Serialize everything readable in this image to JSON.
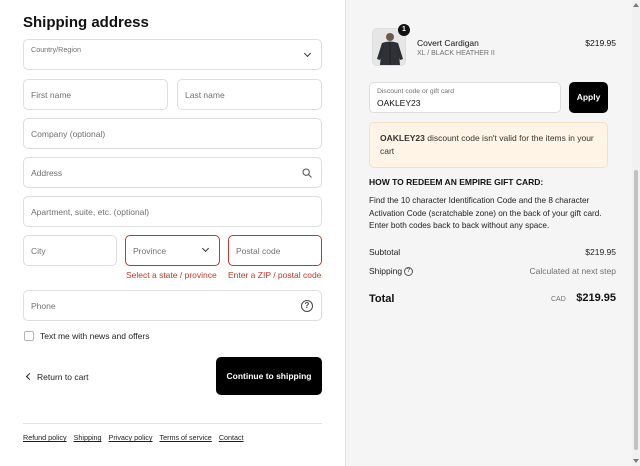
{
  "shipping": {
    "heading": "Shipping address",
    "country_label": "Country/Region",
    "first_name_ph": "First name",
    "last_name_ph": "Last name",
    "company_ph": "Company (optional)",
    "address_ph": "Address",
    "apartment_ph": "Apartment, suite, etc. (optional)",
    "city_ph": "City",
    "province_ph": "Province",
    "postal_ph": "Postal code",
    "province_error": "Select a state / province",
    "postal_error": "Enter a ZIP / postal code",
    "phone_ph": "Phone",
    "newsletter_label": "Text me with news and offers",
    "return_label": "Return to cart",
    "continue_label": "Continue to shipping"
  },
  "footer": {
    "links": [
      "Refund policy",
      "Shipping",
      "Privacy policy",
      "Terms of service",
      "Contact"
    ]
  },
  "summary": {
    "product": {
      "name": "Covert Cardigan",
      "variant": "XL / BLACK HEATHER II",
      "price": "$219.95",
      "quantity": "1"
    },
    "discount": {
      "label": "Discount code or gift card",
      "value": "OAKLEY23",
      "apply_label": "Apply"
    },
    "notice": {
      "code": "OAKLEY23",
      "message": " discount code isn't valid for the items in your cart"
    },
    "redeem": {
      "title": "HOW TO REDEEM AN EMPIRE GIFT CARD:",
      "body": "Find the 10 character Identification Code and the 8 character Activation Code (scratchable zone) on the back of your gift card. Enter both codes back to back without any space."
    },
    "subtotal_label": "Subtotal",
    "subtotal_value": "$219.95",
    "shipping_label": "Shipping",
    "shipping_value": "Calculated at next step",
    "total_label": "Total",
    "total_currency": "CAD",
    "total_value": "$219.95"
  },
  "colors": {
    "error": "#c0392b",
    "notice_bg": "#fff4e5",
    "button": "#000000"
  }
}
